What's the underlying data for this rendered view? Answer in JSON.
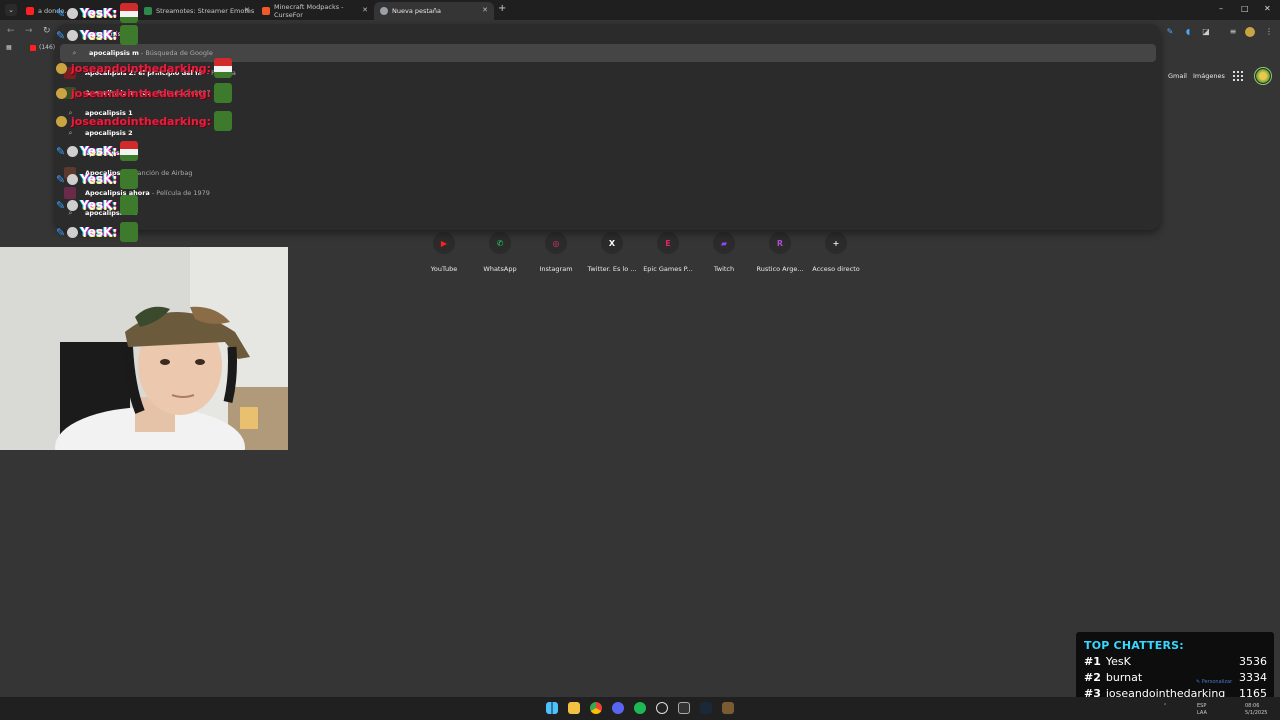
{
  "tabs": [
    {
      "title": "a donde...",
      "favicon_color": "#ff2020"
    },
    {
      "title": "Streamotes: Streamer Emotes",
      "favicon_color": "#2d8a4a"
    },
    {
      "title": "Minecraft Modpacks - CurseFor",
      "favicon_color": "#f05a28"
    },
    {
      "title": "Nueva pestaña",
      "favicon_color": "#9aa0a6"
    }
  ],
  "window_controls": {
    "minimize": "–",
    "maximize": "□",
    "close": "✕"
  },
  "bookmarks": [
    {
      "label": "(146)"
    }
  ],
  "omnibox": {
    "query": "apocalipsis m",
    "suggestions": [
      {
        "icon": "search",
        "main": "apocalipsis m",
        "sub": " - Búsqueda de Google"
      },
      {
        "icon": "thumb",
        "main": "Apocalipsis Z: el principio del fin",
        "sub": " - Película"
      },
      {
        "icon": "thumb",
        "main": "Apocalipsis en los",
        "sub": " - Película de 2007"
      },
      {
        "icon": "search",
        "main": "apocalipsis 1",
        "sub": ""
      },
      {
        "icon": "search",
        "main": "apocalipsis 2",
        "sub": ""
      },
      {
        "icon": "search",
        "main": "apocalipsis 9",
        "sub": ""
      },
      {
        "icon": "thumb",
        "main": "Apocalipsis",
        "sub": " - Canción de Airbag"
      },
      {
        "icon": "thumb",
        "main": "Apocalipsis ahora",
        "sub": " - Película de 1979"
      },
      {
        "icon": "search",
        "main": "apocalipsis 12",
        "sub": ""
      }
    ]
  },
  "chat_overlay": {
    "lines": [
      {
        "name": "YesK:",
        "style": "rainbow",
        "emote": "santa"
      },
      {
        "name": "YesK:",
        "style": "rainbow",
        "emote": "green"
      },
      {
        "name": "joseandointhedarking:",
        "style": "red",
        "emote": "santa"
      },
      {
        "name": "joseandointhedarking:",
        "style": "red",
        "emote": "green"
      },
      {
        "name": "joseandointhedarking:",
        "style": "red",
        "emote": "green"
      },
      {
        "name": "YesK:",
        "style": "rainbow",
        "emote": "santa"
      },
      {
        "name": "YesK:",
        "style": "rainbow",
        "emote": "green"
      },
      {
        "name": "YesK:",
        "style": "rainbow",
        "emote": "green"
      },
      {
        "name": "YesK:",
        "style": "rainbow",
        "emote": "green"
      }
    ]
  },
  "page_links": {
    "gmail": "Gmail",
    "images": "Imágenes"
  },
  "shortcuts": [
    {
      "label": "YouTube",
      "glyph": "▶",
      "color": "#ff2020"
    },
    {
      "label": "WhatsApp",
      "glyph": "✆",
      "color": "#25d366"
    },
    {
      "label": "Instagram",
      "glyph": "◎",
      "color": "#e1306c"
    },
    {
      "label": "Twitter. Es lo ...",
      "glyph": "X",
      "color": "#ffffff"
    },
    {
      "label": "Epic Games P...",
      "glyph": "E",
      "color": "#e0245e"
    },
    {
      "label": "Twitch",
      "glyph": "▰",
      "color": "#9146ff"
    },
    {
      "label": "Rustico Arge...",
      "glyph": "R",
      "color": "#b04ad0"
    },
    {
      "label": "Acceso directo",
      "glyph": "+",
      "color": "#e8eaed"
    }
  ],
  "top_chatters": {
    "title": "TOP CHATTERS:",
    "rows": [
      {
        "rank": "#1",
        "name": "YesK",
        "count": "3536"
      },
      {
        "rank": "#2",
        "name": "burnat",
        "count": "3334"
      },
      {
        "rank": "#3",
        "name": "joseandointhedarking",
        "count": "1165"
      }
    ]
  },
  "customize_label": "Personalizar",
  "tray": {
    "lang": "ESP",
    "lang2": "LAA",
    "time": "08:06",
    "date": "5/1/2025"
  }
}
